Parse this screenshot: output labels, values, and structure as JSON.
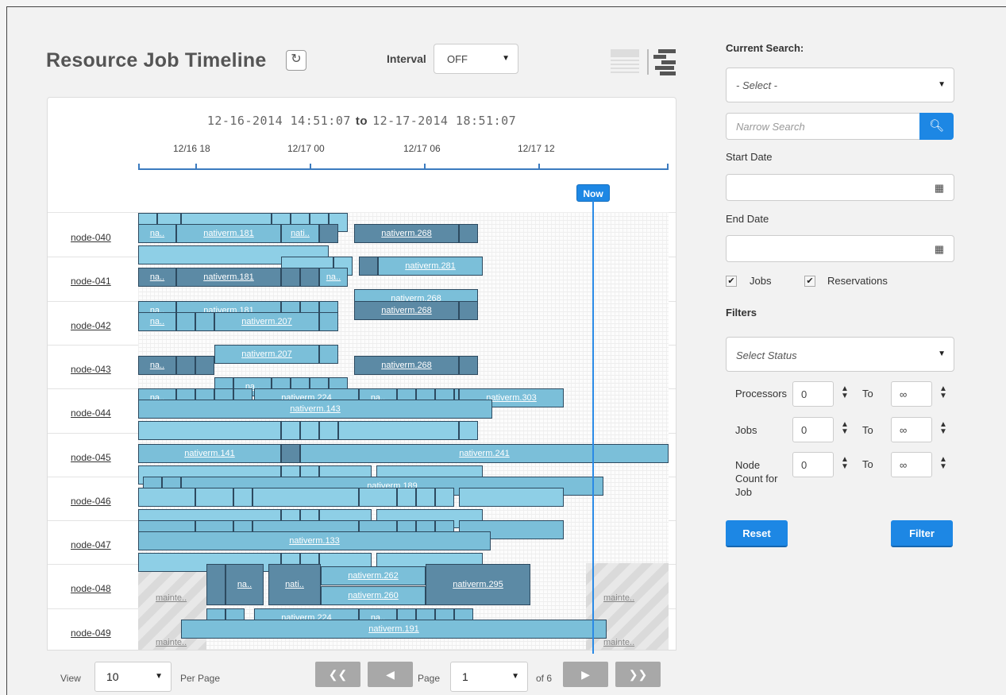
{
  "header": {
    "title": "Resource Job Timeline",
    "refresh_icon": "refresh-icon",
    "interval_label": "Interval",
    "interval_value": "OFF"
  },
  "timeline": {
    "range_start": "12-16-2014 14:51:07",
    "range_to": "to",
    "range_end": "12-17-2014 18:51:07",
    "axis_labels": [
      "12/16 18",
      "12/17 00",
      "12/17 06",
      "12/17 12"
    ],
    "now_label": "Now",
    "nodes": [
      "node-040",
      "node-041",
      "node-042",
      "node-043",
      "node-044",
      "node-045",
      "node-046",
      "node-047",
      "node-048",
      "node-049"
    ],
    "maintenance_label": "mainte..",
    "bars": [
      {
        "row": 0,
        "lane": 0,
        "s": 0,
        "e": 24,
        "c": "lt",
        "t": ""
      },
      {
        "row": 0,
        "lane": 0,
        "s": 24,
        "e": 54,
        "c": "lt",
        "t": ""
      },
      {
        "row": 0,
        "lane": 0,
        "s": 54,
        "e": 168,
        "c": "lt",
        "t": ""
      },
      {
        "row": 0,
        "lane": 0,
        "s": 168,
        "e": 192,
        "c": "lt",
        "t": ""
      },
      {
        "row": 0,
        "lane": 0,
        "s": 192,
        "e": 216,
        "c": "lt",
        "t": ""
      },
      {
        "row": 0,
        "lane": 0,
        "s": 216,
        "e": 240,
        "c": "lt",
        "t": ""
      },
      {
        "row": 0,
        "lane": 0,
        "s": 240,
        "e": 264,
        "c": "lt",
        "t": ""
      },
      {
        "row": 0,
        "lane": 1,
        "s": 0,
        "e": 48,
        "c": "md",
        "t": "na.."
      },
      {
        "row": 0,
        "lane": 1,
        "s": 48,
        "e": 180,
        "c": "md",
        "t": "nativerm.181"
      },
      {
        "row": 0,
        "lane": 1,
        "s": 180,
        "e": 228,
        "c": "md",
        "t": "nati.."
      },
      {
        "row": 0,
        "lane": 1,
        "s": 228,
        "e": 252,
        "c": "dk",
        "t": ""
      },
      {
        "row": 0,
        "lane": 1,
        "s": 272,
        "e": 404,
        "c": "dk",
        "t": "nativerm.268"
      },
      {
        "row": 0,
        "lane": 1,
        "s": 404,
        "e": 428,
        "c": "dk",
        "t": ""
      },
      {
        "row": 0,
        "lane": 2,
        "s": 0,
        "e": 240,
        "c": "lt",
        "t": ""
      },
      {
        "row": 1,
        "lane": 0,
        "s": 180,
        "e": 246,
        "c": "lt",
        "t": ""
      },
      {
        "row": 1,
        "lane": 0,
        "s": 246,
        "e": 270,
        "c": "lt",
        "t": ""
      },
      {
        "row": 1,
        "lane": 0,
        "s": 278,
        "e": 302,
        "c": "dk",
        "t": ""
      },
      {
        "row": 1,
        "lane": 0,
        "s": 302,
        "e": 434,
        "c": "md",
        "t": "nativerm.281"
      },
      {
        "row": 1,
        "lane": 1,
        "s": 0,
        "e": 48,
        "c": "dk",
        "t": "na.."
      },
      {
        "row": 1,
        "lane": 1,
        "s": 48,
        "e": 180,
        "c": "dk",
        "t": "nativerm.181"
      },
      {
        "row": 1,
        "lane": 1,
        "s": 180,
        "e": 204,
        "c": "dk",
        "t": ""
      },
      {
        "row": 1,
        "lane": 1,
        "s": 204,
        "e": 228,
        "c": "dk",
        "t": ""
      },
      {
        "row": 1,
        "lane": 1,
        "s": 228,
        "e": 264,
        "c": "md",
        "t": "na.."
      },
      {
        "row": 1,
        "lane": 2,
        "s": 272,
        "e": 428,
        "c": "md",
        "t": "nativerm.268"
      },
      {
        "row": 2,
        "lane": 0,
        "s": 0,
        "e": 48,
        "c": "md",
        "t": "na.."
      },
      {
        "row": 2,
        "lane": 0,
        "s": 48,
        "e": 180,
        "c": "md",
        "t": "nativerm.181"
      },
      {
        "row": 2,
        "lane": 0,
        "s": 180,
        "e": 204,
        "c": "md",
        "t": ""
      },
      {
        "row": 2,
        "lane": 0,
        "s": 204,
        "e": 228,
        "c": "md",
        "t": ""
      },
      {
        "row": 2,
        "lane": 0,
        "s": 228,
        "e": 252,
        "c": "md",
        "t": ""
      },
      {
        "row": 2,
        "lane": 0,
        "s": 272,
        "e": 404,
        "c": "dk",
        "t": "nativerm.268"
      },
      {
        "row": 2,
        "lane": 0,
        "s": 404,
        "e": 428,
        "c": "dk",
        "t": ""
      },
      {
        "row": 2,
        "lane": 1,
        "s": 0,
        "e": 48,
        "c": "md",
        "t": "na.."
      },
      {
        "row": 2,
        "lane": 1,
        "s": 48,
        "e": 72,
        "c": "md",
        "t": ""
      },
      {
        "row": 2,
        "lane": 1,
        "s": 72,
        "e": 96,
        "c": "md",
        "t": ""
      },
      {
        "row": 2,
        "lane": 1,
        "s": 96,
        "e": 228,
        "c": "md",
        "t": "nativerm.207"
      },
      {
        "row": 2,
        "lane": 1,
        "s": 228,
        "e": 252,
        "c": "md",
        "t": ""
      },
      {
        "row": 3,
        "lane": 0,
        "s": 96,
        "e": 228,
        "c": "md",
        "t": "nativerm.207"
      },
      {
        "row": 3,
        "lane": 0,
        "s": 228,
        "e": 252,
        "c": "md",
        "t": ""
      },
      {
        "row": 3,
        "lane": 1,
        "s": 0,
        "e": 48,
        "c": "dk",
        "t": "na.."
      },
      {
        "row": 3,
        "lane": 1,
        "s": 48,
        "e": 72,
        "c": "dk",
        "t": ""
      },
      {
        "row": 3,
        "lane": 1,
        "s": 72,
        "e": 96,
        "c": "dk",
        "t": ""
      },
      {
        "row": 3,
        "lane": 1,
        "s": 272,
        "e": 404,
        "c": "dk",
        "t": "nativerm.268"
      },
      {
        "row": 3,
        "lane": 1,
        "s": 404,
        "e": 428,
        "c": "dk",
        "t": ""
      },
      {
        "row": 3,
        "lane": 2,
        "s": 96,
        "e": 120,
        "c": "md",
        "t": ""
      },
      {
        "row": 3,
        "lane": 2,
        "s": 120,
        "e": 168,
        "c": "md",
        "t": "na.."
      },
      {
        "row": 3,
        "lane": 2,
        "s": 168,
        "e": 192,
        "c": "md",
        "t": ""
      },
      {
        "row": 3,
        "lane": 2,
        "s": 192,
        "e": 216,
        "c": "md",
        "t": ""
      },
      {
        "row": 3,
        "lane": 2,
        "s": 216,
        "e": 240,
        "c": "md",
        "t": ""
      },
      {
        "row": 3,
        "lane": 2,
        "s": 240,
        "e": 264,
        "c": "md",
        "t": ""
      },
      {
        "row": 4,
        "lane": 0,
        "s": 0,
        "e": 48,
        "c": "md",
        "t": "na.."
      },
      {
        "row": 4,
        "lane": 0,
        "s": 48,
        "e": 72,
        "c": "md",
        "t": ""
      },
      {
        "row": 4,
        "lane": 0,
        "s": 72,
        "e": 96,
        "c": "md",
        "t": ""
      },
      {
        "row": 4,
        "lane": 0,
        "s": 96,
        "e": 120,
        "c": "md",
        "t": ""
      },
      {
        "row": 4,
        "lane": 0,
        "s": 120,
        "e": 144,
        "c": "md",
        "t": ""
      },
      {
        "row": 4,
        "lane": 0,
        "s": 146,
        "e": 278,
        "c": "md",
        "t": "nativerm.224"
      },
      {
        "row": 4,
        "lane": 0,
        "s": 278,
        "e": 326,
        "c": "md",
        "t": "na.."
      },
      {
        "row": 4,
        "lane": 0,
        "s": 326,
        "e": 350,
        "c": "md",
        "t": ""
      },
      {
        "row": 4,
        "lane": 0,
        "s": 350,
        "e": 374,
        "c": "md",
        "t": ""
      },
      {
        "row": 4,
        "lane": 0,
        "s": 374,
        "e": 398,
        "c": "md",
        "t": ""
      },
      {
        "row": 4,
        "lane": 0,
        "s": 398,
        "e": 404,
        "c": "md",
        "t": ""
      },
      {
        "row": 4,
        "lane": 0,
        "s": 404,
        "e": 536,
        "c": "md",
        "t": "nativerm.303"
      },
      {
        "row": 4,
        "lane": 1,
        "s": 0,
        "e": 446,
        "c": "md",
        "t": "nativerm.143"
      },
      {
        "row": 4,
        "lane": 2,
        "s": 0,
        "e": 180,
        "c": "lt",
        "t": ""
      },
      {
        "row": 4,
        "lane": 2,
        "s": 180,
        "e": 204,
        "c": "lt",
        "t": ""
      },
      {
        "row": 4,
        "lane": 2,
        "s": 204,
        "e": 228,
        "c": "lt",
        "t": ""
      },
      {
        "row": 4,
        "lane": 2,
        "s": 228,
        "e": 252,
        "c": "lt",
        "t": ""
      },
      {
        "row": 4,
        "lane": 2,
        "s": 252,
        "e": 404,
        "c": "lt",
        "t": ""
      },
      {
        "row": 4,
        "lane": 2,
        "s": 404,
        "e": 428,
        "c": "lt",
        "t": ""
      },
      {
        "row": 5,
        "lane": 1,
        "s": 0,
        "e": 180,
        "c": "md",
        "t": "nativerm.141"
      },
      {
        "row": 5,
        "lane": 1,
        "s": 180,
        "e": 204,
        "c": "dk",
        "t": ""
      },
      {
        "row": 5,
        "lane": 1,
        "s": 204,
        "e": 668,
        "c": "md",
        "t": "nativerm.241"
      },
      {
        "row": 5,
        "lane": 2,
        "s": 0,
        "e": 180,
        "c": "lt",
        "t": ""
      },
      {
        "row": 5,
        "lane": 2,
        "s": 180,
        "e": 204,
        "c": "lt",
        "t": ""
      },
      {
        "row": 5,
        "lane": 2,
        "s": 204,
        "e": 228,
        "c": "lt",
        "t": ""
      },
      {
        "row": 5,
        "lane": 2,
        "s": 228,
        "e": 294,
        "c": "lt",
        "t": ""
      },
      {
        "row": 5,
        "lane": 2,
        "s": 300,
        "e": 434,
        "c": "lt",
        "t": ""
      },
      {
        "row": 6,
        "lane": 0,
        "s": 6,
        "e": 30,
        "c": "md",
        "t": ""
      },
      {
        "row": 6,
        "lane": 0,
        "s": 30,
        "e": 54,
        "c": "md",
        "t": ""
      },
      {
        "row": 6,
        "lane": 0,
        "s": 54,
        "e": 586,
        "c": "md",
        "t": "nativerm.189"
      },
      {
        "row": 6,
        "lane": 1,
        "s": 0,
        "e": 72,
        "c": "lt",
        "t": ""
      },
      {
        "row": 6,
        "lane": 1,
        "s": 72,
        "e": 120,
        "c": "lt",
        "t": ""
      },
      {
        "row": 6,
        "lane": 1,
        "s": 120,
        "e": 144,
        "c": "lt",
        "t": ""
      },
      {
        "row": 6,
        "lane": 1,
        "s": 144,
        "e": 278,
        "c": "lt",
        "t": ""
      },
      {
        "row": 6,
        "lane": 1,
        "s": 278,
        "e": 326,
        "c": "lt",
        "t": ""
      },
      {
        "row": 6,
        "lane": 1,
        "s": 326,
        "e": 350,
        "c": "lt",
        "t": ""
      },
      {
        "row": 6,
        "lane": 1,
        "s": 350,
        "e": 374,
        "c": "lt",
        "t": ""
      },
      {
        "row": 6,
        "lane": 1,
        "s": 374,
        "e": 398,
        "c": "lt",
        "t": ""
      },
      {
        "row": 6,
        "lane": 1,
        "s": 404,
        "e": 536,
        "c": "lt",
        "t": ""
      },
      {
        "row": 6,
        "lane": 2,
        "s": 0,
        "e": 180,
        "c": "lt",
        "t": ""
      },
      {
        "row": 6,
        "lane": 2,
        "s": 180,
        "e": 204,
        "c": "lt",
        "t": ""
      },
      {
        "row": 6,
        "lane": 2,
        "s": 204,
        "e": 228,
        "c": "lt",
        "t": ""
      },
      {
        "row": 6,
        "lane": 2,
        "s": 228,
        "e": 294,
        "c": "lt",
        "t": ""
      },
      {
        "row": 6,
        "lane": 2,
        "s": 300,
        "e": 434,
        "c": "lt",
        "t": ""
      },
      {
        "row": 7,
        "lane": 0,
        "s": 0,
        "e": 72,
        "c": "md",
        "t": ""
      },
      {
        "row": 7,
        "lane": 0,
        "s": 72,
        "e": 120,
        "c": "md",
        "t": ""
      },
      {
        "row": 7,
        "lane": 0,
        "s": 120,
        "e": 144,
        "c": "md",
        "t": ""
      },
      {
        "row": 7,
        "lane": 0,
        "s": 144,
        "e": 278,
        "c": "md",
        "t": ""
      },
      {
        "row": 7,
        "lane": 0,
        "s": 278,
        "e": 326,
        "c": "md",
        "t": ""
      },
      {
        "row": 7,
        "lane": 0,
        "s": 326,
        "e": 350,
        "c": "md",
        "t": ""
      },
      {
        "row": 7,
        "lane": 0,
        "s": 350,
        "e": 374,
        "c": "md",
        "t": ""
      },
      {
        "row": 7,
        "lane": 0,
        "s": 374,
        "e": 398,
        "c": "md",
        "t": ""
      },
      {
        "row": 7,
        "lane": 0,
        "s": 404,
        "e": 536,
        "c": "md",
        "t": ""
      },
      {
        "row": 7,
        "lane": 1,
        "s": 0,
        "e": 444,
        "c": "md",
        "t": "nativerm.133"
      },
      {
        "row": 7,
        "lane": 2,
        "s": 0,
        "e": 180,
        "c": "lt",
        "t": ""
      },
      {
        "row": 7,
        "lane": 2,
        "s": 180,
        "e": 204,
        "c": "lt",
        "t": ""
      },
      {
        "row": 7,
        "lane": 2,
        "s": 204,
        "e": 228,
        "c": "lt",
        "t": ""
      },
      {
        "row": 7,
        "lane": 2,
        "s": 228,
        "e": 294,
        "c": "lt",
        "t": ""
      },
      {
        "row": 7,
        "lane": 2,
        "s": 300,
        "e": 434,
        "c": "lt",
        "t": ""
      },
      {
        "row": 8,
        "lane": "a",
        "s": 86,
        "e": 110,
        "c": "dk",
        "t": ""
      },
      {
        "row": 8,
        "lane": "a",
        "s": 110,
        "e": 158,
        "c": "dk",
        "t": "na.."
      },
      {
        "row": 8,
        "lane": "a",
        "s": 164,
        "e": 230,
        "c": "dk",
        "t": "nati.."
      },
      {
        "row": 8,
        "lane": "a",
        "s": 362,
        "e": 494,
        "c": "dk",
        "t": "nativerm.295"
      },
      {
        "row": 8,
        "lane": "b",
        "s": 230,
        "e": 362,
        "c": "md",
        "t": "nativerm.262"
      },
      {
        "row": 8,
        "lane": "c",
        "s": 230,
        "e": 362,
        "c": "md",
        "t": "nativerm.260"
      },
      {
        "row": 9,
        "lane": 0,
        "s": 86,
        "e": 110,
        "c": "md",
        "t": ""
      },
      {
        "row": 9,
        "lane": 0,
        "s": 110,
        "e": 134,
        "c": "md",
        "t": ""
      },
      {
        "row": 9,
        "lane": 0,
        "s": 146,
        "e": 278,
        "c": "md",
        "t": "nativerm.224"
      },
      {
        "row": 9,
        "lane": 0,
        "s": 278,
        "e": 326,
        "c": "md",
        "t": "na.."
      },
      {
        "row": 9,
        "lane": 0,
        "s": 326,
        "e": 350,
        "c": "md",
        "t": ""
      },
      {
        "row": 9,
        "lane": 0,
        "s": 350,
        "e": 374,
        "c": "md",
        "t": ""
      },
      {
        "row": 9,
        "lane": 0,
        "s": 374,
        "e": 398,
        "c": "md",
        "t": ""
      },
      {
        "row": 9,
        "lane": 0,
        "s": 398,
        "e": 422,
        "c": "md",
        "t": ""
      },
      {
        "row": 9,
        "lane": 1,
        "s": 54,
        "e": 590,
        "c": "md",
        "t": "nativerm.191"
      }
    ]
  },
  "pager": {
    "view_label": "View",
    "per_page_value": "10",
    "per_page_label": "Per Page",
    "page_label": "Page",
    "page_value": "1",
    "of_label": "of 6",
    "first_icon": "double-left-icon",
    "prev_icon": "left-icon",
    "next_icon": "right-icon",
    "last_icon": "double-right-icon"
  },
  "sidebar": {
    "current_search_label": "Current Search:",
    "current_search_value": "- Select -",
    "narrow_search_placeholder": "Narrow Search",
    "start_date_label": "Start Date",
    "end_date_label": "End Date",
    "jobs_label": "Jobs",
    "reservations_label": "Reservations",
    "filters_label": "Filters",
    "status_value": "Select Status",
    "processors_label": "Processors",
    "jobs_filter_label": "Jobs",
    "node_count_label": "Node Count for Job",
    "to_label": "To",
    "min_value": "0",
    "max_value": "∞",
    "reset_label": "Reset",
    "filter_label": "Filter"
  },
  "colors": {
    "accent": "#1d87e4",
    "bar_light": "#8ecfe6",
    "bar_medium": "#7bbfd9",
    "bar_dark": "#5c8aa5"
  }
}
